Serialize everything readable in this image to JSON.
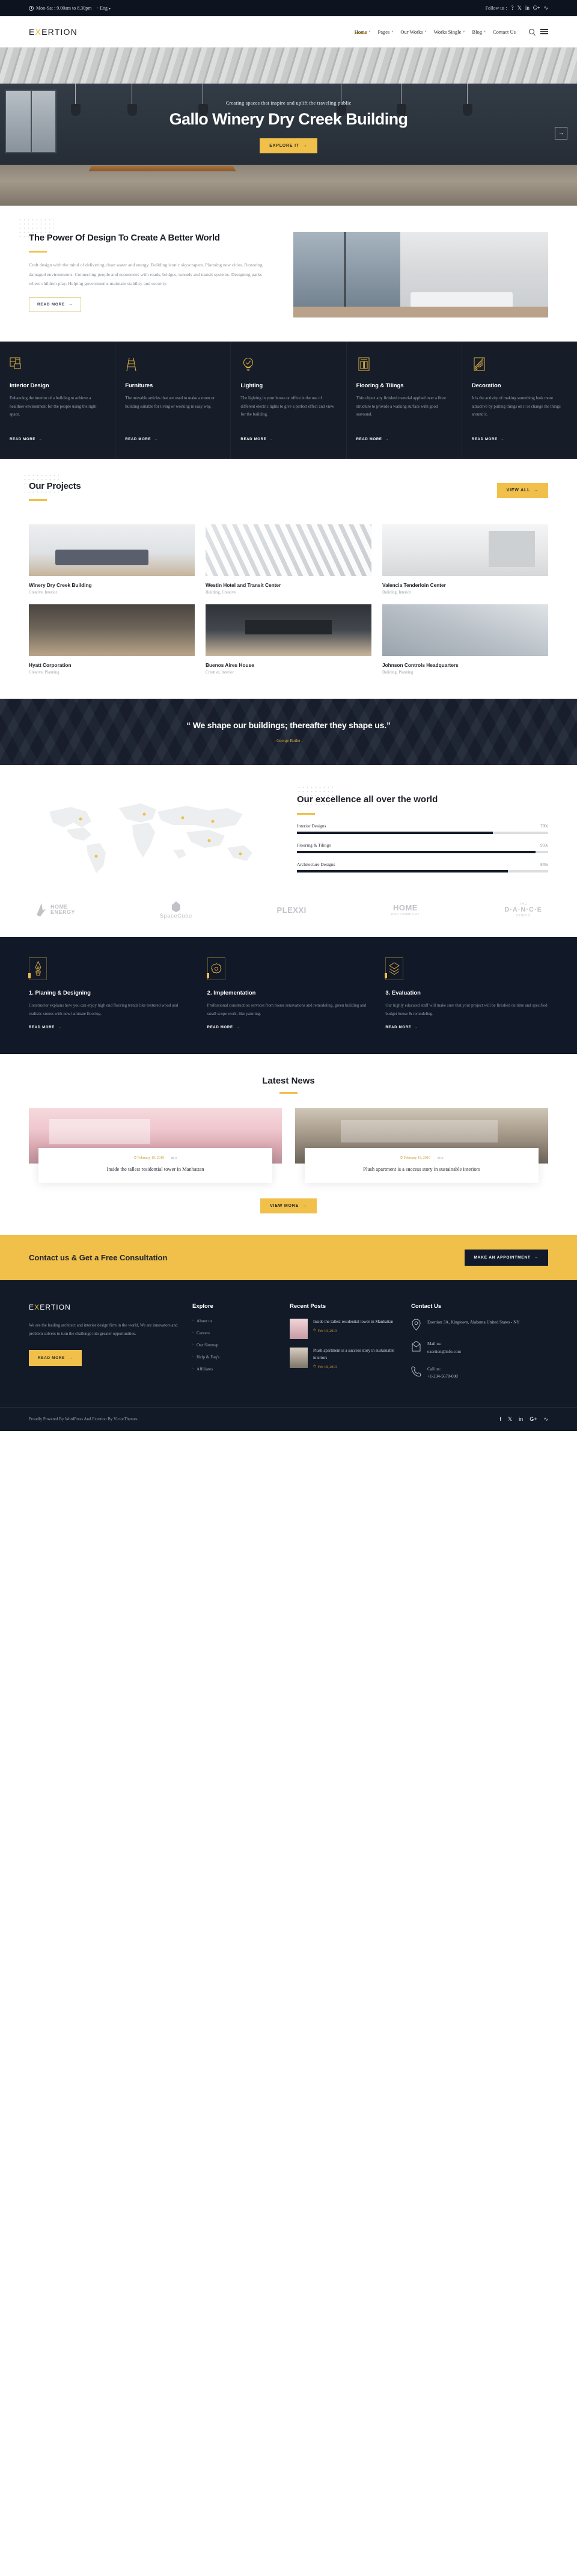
{
  "topbar": {
    "hours": "Mon-Sat : 9.00am to 8.30pm",
    "lang": "Eng",
    "follow_label": "Follow us :",
    "socials": [
      "facebook-icon",
      "twitter-icon",
      "linkedin-icon",
      "google-plus-icon",
      "rss-icon"
    ]
  },
  "header": {
    "logo_pre": "E",
    "logo_x": "X",
    "logo_post": "ERTION",
    "nav": [
      {
        "label": "Home",
        "caret": true,
        "active": true
      },
      {
        "label": "Pages",
        "caret": true,
        "active": false
      },
      {
        "label": "Our Works",
        "caret": true,
        "active": false
      },
      {
        "label": "Works Single",
        "caret": true,
        "active": false
      },
      {
        "label": "Blog",
        "caret": true,
        "active": false
      },
      {
        "label": "Contact Us",
        "caret": false,
        "active": false
      }
    ]
  },
  "hero": {
    "subtitle": "Creating spaces that inspire and uplift the traveling public",
    "title": "Gallo Winery Dry Creek Building",
    "cta": "EXPLORE IT",
    "arrow": "→"
  },
  "power": {
    "title": "The Power Of Design To Create A Better World",
    "paragraph": "Craft design with the mind of delivering clean water and energy. Building iconic skyscrapers. Planning new cities. Restoring damaged environments. Connecting people and economies with roads, bridges, tunnels and transit systems. Designing parks where children play. Helping governments maintain stability and security.",
    "button": "READ MORE"
  },
  "services": [
    {
      "icon": "floorplan-icon",
      "title": "Interior Design",
      "text": "Enhancing the interior of a building to achieve a healthier environment for the people using the right space.",
      "link": "READ MORE"
    },
    {
      "icon": "ladder-icon",
      "title": "Furnitures",
      "text": "The movable articles that are used to make a room or building suitable for living or working in easy way.",
      "link": "READ MORE"
    },
    {
      "icon": "bulb-icon",
      "title": "Lighting",
      "text": "The lighting in your house or office is the use of different electric lights to give a perfect effect and view for the building.",
      "link": "READ MORE"
    },
    {
      "icon": "tiles-icon",
      "title": "Flooring & Tilings",
      "text": "Thin object any finished material applied over a floor structure to provide a walking surface with good surround.",
      "link": "READ MORE"
    },
    {
      "icon": "fan-icon",
      "title": "Decoration",
      "text": "It is the activity of making something look more attractive by putting things on it or change the things around it.",
      "link": "READ MORE"
    }
  ],
  "projects": {
    "title": "Our Projects",
    "view_all": "VIEW ALL",
    "items": [
      {
        "title": "Winery Dry Creek Building",
        "cats": "Creative, Interior",
        "img": "im1"
      },
      {
        "title": "Westin Hotel and Transit Center",
        "cats": "Building, Creative",
        "img": "im2"
      },
      {
        "title": "Valencia Tenderloin Center",
        "cats": "Building, Interior",
        "img": "im3"
      },
      {
        "title": "Hyatt Corporation",
        "cats": "Creative, Planning",
        "img": "im4"
      },
      {
        "title": "Buenos Aires House",
        "cats": "Creative, Interior",
        "img": "im5"
      },
      {
        "title": "Johnson Controls Headquarters",
        "cats": "Building, Planning",
        "img": "im6"
      }
    ]
  },
  "quote": {
    "text": "“ We shape our buildings; thereafter they shape us.”",
    "author": "- George Butler -"
  },
  "excellence": {
    "title": "Our excellence all over the world",
    "chart_data": {
      "type": "bar",
      "orientation": "horizontal",
      "title": "Our excellence all over the world",
      "categories": [
        "Interior Designs",
        "Flooring & Tilings",
        "Architecture Designs"
      ],
      "values": [
        78,
        95,
        84
      ],
      "unit": "%",
      "xlim": [
        0,
        100
      ],
      "grid": false,
      "bar_color": "#131b28",
      "track_color": "#dcdee0"
    }
  },
  "brands": [
    {
      "name": "HOME ENERGY",
      "line1": "HOME",
      "line2": "ENERGY"
    },
    {
      "name": "SpaceCube",
      "line1": "SpaceCube",
      "line2": ""
    },
    {
      "name": "PLEXXI",
      "line1": "PLEXXI",
      "line2": ""
    },
    {
      "name": "HOME AND COMFORT",
      "line1": "HOME",
      "line2": "AND COMFORT"
    },
    {
      "name": "THE DANCE STUDIO",
      "line1": "D·A·N·C·E",
      "line2": "STUDIO"
    }
  ],
  "steps": [
    {
      "icon": "pen-nib-icon",
      "title": "1. Planing & Designing",
      "text": "Constructor explains how you can enjoy high end flooring trends like textured wood and realistic stones with new laminate flooring.",
      "link": "READ MORE"
    },
    {
      "icon": "gear-icon",
      "title": "2. Implementation",
      "text": "Professional construction services from house renovations and remodeling, green building and small scope work, like painting.",
      "link": "READ MORE"
    },
    {
      "icon": "layers-icon",
      "title": "3. Evaluation",
      "text": "Our highly educated staff will make sure that your project will be finished on time and specified budget house & remodeling.",
      "link": "READ MORE"
    }
  ],
  "news": {
    "title": "Latest News",
    "button": "VIEW MORE",
    "items": [
      {
        "date": "February 19, 2019",
        "comments": "0",
        "title": "Inside the tallest residential tower in Manhattan",
        "img": "nim1"
      },
      {
        "date": "February 18, 2019",
        "comments": "0",
        "title": "Plush apartment is a success story in sustainable interiors",
        "img": "nim2"
      }
    ]
  },
  "cta": {
    "title": "Contact us & Get a Free Consultation",
    "button": "MAKE AN APPOINTMENT"
  },
  "footer": {
    "logo_pre": "E",
    "logo_x": "X",
    "logo_post": "ERTION",
    "about": "We are the leading architect and interior design firm in the world, We are innovators and problem solvers to turn the challenge into greater opportunities.",
    "about_button": "READ MORE",
    "explore_title": "Explore",
    "explore_links": [
      "About us",
      "Careers",
      "Our Sitemap",
      "Help & Faq's",
      "Affiliates"
    ],
    "recent_title": "Recent Posts",
    "recent_posts": [
      {
        "title": "Inside the tallest residential tower in Manhattan",
        "date": "Feb 19, 2019",
        "img": "rpi1"
      },
      {
        "title": "Plush apartment is a success story in sustainable interiors",
        "date": "Feb 18, 2019",
        "img": "rpi2"
      }
    ],
    "contact_title": "Contact Us",
    "contact": [
      {
        "icon": "location-pin-icon",
        "label": "",
        "value": "Exertion 3A, Kingtown, Alabama United States - NY"
      },
      {
        "icon": "mail-icon",
        "label": "Mail us:",
        "value": "exertion@info.com"
      },
      {
        "icon": "phone-icon",
        "label": "Call us:",
        "value": "+1-234-5678-000"
      }
    ],
    "copyright": "Proudly Powered By WordPress And Exertion By VictorThemes",
    "socials": [
      "facebook-icon",
      "twitter-icon",
      "linkedin-icon",
      "google-plus-icon",
      "rss-icon"
    ]
  },
  "colors": {
    "accent": "#f0c04a",
    "dark": "#121a28",
    "darker": "#0d1420"
  }
}
